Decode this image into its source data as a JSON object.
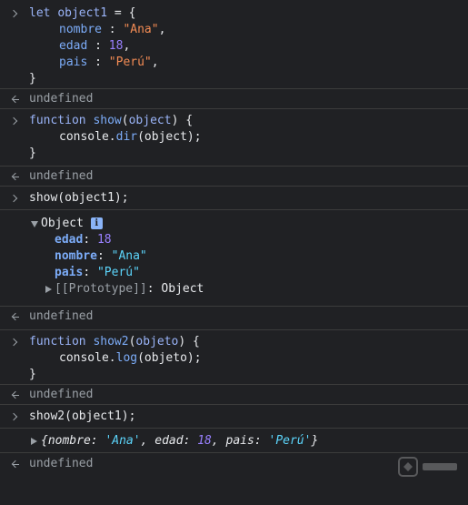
{
  "entries": {
    "e1": {
      "l1": {
        "kw": "let",
        "name": "object1",
        "rest": " = {"
      },
      "l2": {
        "key": "nombre",
        "sep": " : ",
        "val": "\"Ana\"",
        "end": ","
      },
      "l3": {
        "key": "edad",
        "sep": " : ",
        "val": "18",
        "end": ","
      },
      "l4": {
        "key": "pais",
        "sep": " : ",
        "val": "\"Perú\"",
        "end": ","
      },
      "l5": "}"
    },
    "r1": "undefined",
    "e2": {
      "l1": {
        "kw": "function",
        "name": "show",
        "open": "(",
        "param": "object",
        "close": ") {"
      },
      "l2": {
        "obj": "console.",
        "method": "dir",
        "args": "(object);"
      },
      "l3": "}"
    },
    "r2": "undefined",
    "e3": "show(object1);",
    "o3": {
      "title": "Object",
      "badge": "i",
      "props": [
        {
          "key": "edad",
          "val": "18",
          "type": "num"
        },
        {
          "key": "nombre",
          "val": "\"Ana\"",
          "type": "str"
        },
        {
          "key": "pais",
          "val": "\"Perú\"",
          "type": "str"
        }
      ],
      "proto_key": "[[Prototype]]",
      "proto_val": "Object"
    },
    "r3": "undefined",
    "e4": {
      "l1": {
        "kw": "function",
        "name": "show2",
        "open": "(",
        "param": "objeto",
        "close": ") {"
      },
      "l2": {
        "obj": "console.",
        "method": "log",
        "args": "(objeto);"
      },
      "l3": "}"
    },
    "r4": "undefined",
    "e5": "show2(object1);",
    "o5": {
      "open": "{",
      "k1": "nombre",
      "v1": "'Ana'",
      "k2": "edad",
      "v2": "18",
      "k3": "pais",
      "v3": "'Perú'",
      "close": "}"
    },
    "r5": "undefined"
  },
  "colors": {
    "background": "#202124",
    "keyword": "#9ab4f8",
    "string": "#f28b54",
    "number": "#9980ff",
    "divider": "#3c3c3c"
  },
  "icons": {
    "input_prompt": "chevron-right-icon",
    "return_prompt": "return-arrow-icon",
    "expand": "triangle-down-icon",
    "collapse": "triangle-right-icon",
    "info": "info-icon"
  }
}
